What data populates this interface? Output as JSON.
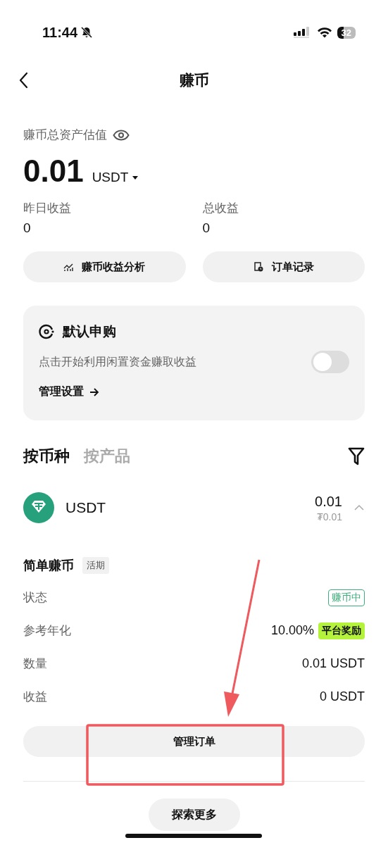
{
  "status_bar": {
    "time": "11:44",
    "silent": true,
    "battery": "32"
  },
  "nav": {
    "title": "赚币"
  },
  "summary": {
    "label": "赚币总资产估值",
    "amount": "0.01",
    "unit": "USDT",
    "stats": [
      {
        "label": "昨日收益",
        "value": "0"
      },
      {
        "label": "总收益",
        "value": "0"
      }
    ],
    "buttons": [
      {
        "label": "赚币收益分析",
        "kind": "chart"
      },
      {
        "label": "订单记录",
        "kind": "record"
      }
    ]
  },
  "auto_subscribe": {
    "title": "默认申购",
    "description": "点击开始利用闲置资金赚取收益",
    "on": false,
    "link": "管理设置"
  },
  "tabs": [
    {
      "label": "按币种",
      "selected": true
    },
    {
      "label": "按产品",
      "selected": false
    }
  ],
  "asset": {
    "name": "USDT",
    "amount": "0.01",
    "fiat": "₮0.01",
    "expanded": true
  },
  "product": {
    "title": "简单赚币",
    "tag": "活期",
    "rows": [
      {
        "label": "状态",
        "value": "赚币中",
        "kind": "status"
      },
      {
        "label": "参考年化",
        "value": "10.00%",
        "badge": "平台奖励",
        "kind": "rate"
      },
      {
        "label": "数量",
        "value": "0.01 USDT",
        "kind": "text"
      },
      {
        "label": "收益",
        "value": "0 USDT",
        "kind": "text"
      }
    ],
    "button": "管理订单"
  },
  "explore_button": "探索更多"
}
